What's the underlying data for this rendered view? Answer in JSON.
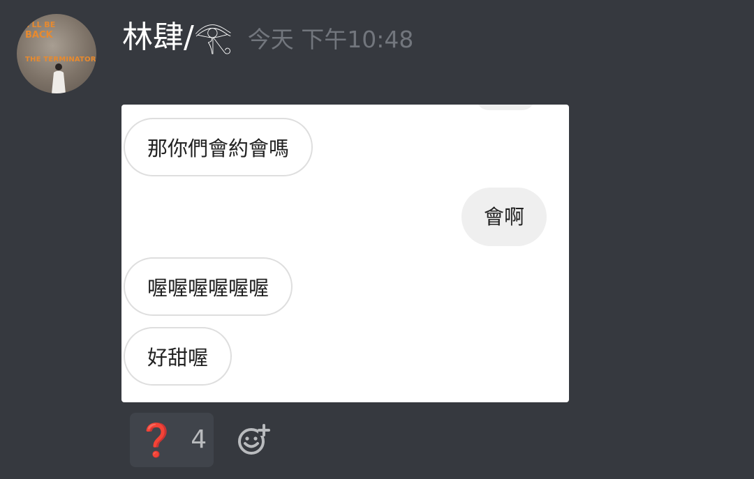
{
  "message": {
    "author": "林肆/𓂀",
    "timestamp": "今天 下午10:48",
    "avatar": {
      "icon": "avatar-photo",
      "poster_lines": [
        "I'LL BE",
        "BACK",
        "THE TERMINATOR"
      ]
    }
  },
  "chat_screenshot": {
    "bubbles": [
      {
        "side": "incoming",
        "text": "那你們會約會嗎"
      },
      {
        "side": "outgoing",
        "text": "會啊"
      },
      {
        "side": "incoming",
        "text": "喔喔喔喔喔喔"
      },
      {
        "side": "incoming",
        "text": "好甜喔"
      }
    ]
  },
  "reactions": [
    {
      "emoji": "❓",
      "count": "4",
      "color": "#dd2e44"
    }
  ],
  "add_reaction": {
    "icon": "add-reaction-smiley-icon"
  },
  "colors": {
    "background": "#36393f",
    "username": "#ffffff",
    "timestamp": "#72767d",
    "reaction_bg": "#40444b",
    "reaction_count": "#b9bbbe",
    "bubble_out_bg": "#efefef",
    "bubble_border": "#dedede"
  }
}
